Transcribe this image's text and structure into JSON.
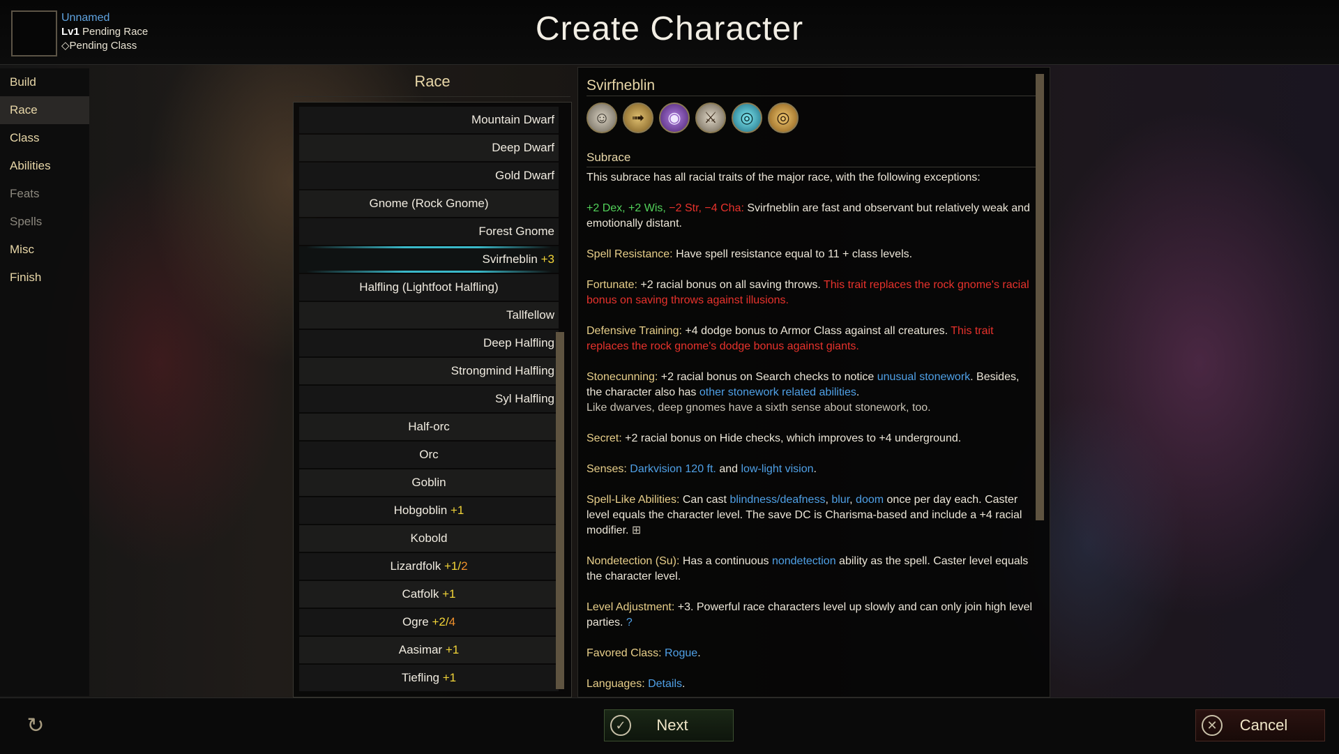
{
  "header": {
    "title": "Create Character",
    "character": {
      "name": "Unnamed",
      "level": "Lv1",
      "race": "Pending Race",
      "class": "Pending Class"
    }
  },
  "nav": {
    "items": [
      {
        "label": "Build"
      },
      {
        "label": "Race"
      },
      {
        "label": "Class"
      },
      {
        "label": "Abilities"
      },
      {
        "label": "Feats"
      },
      {
        "label": "Spells"
      },
      {
        "label": "Misc"
      },
      {
        "label": "Finish"
      }
    ]
  },
  "race_list": {
    "title": "Race",
    "items": [
      {
        "name": "Mountain Dwarf",
        "adj": ""
      },
      {
        "name": "Deep Dwarf",
        "adj": ""
      },
      {
        "name": "Gold Dwarf",
        "adj": ""
      },
      {
        "name": "Gnome (Rock Gnome)",
        "adj": ""
      },
      {
        "name": "Forest Gnome",
        "adj": ""
      },
      {
        "name": "Svirfneblin",
        "adj": "+3"
      },
      {
        "name": "Halfling (Lightfoot Halfling)",
        "adj": ""
      },
      {
        "name": "Tallfellow",
        "adj": ""
      },
      {
        "name": "Deep Halfling",
        "adj": ""
      },
      {
        "name": "Strongmind Halfling",
        "adj": ""
      },
      {
        "name": "Syl Halfling",
        "adj": ""
      },
      {
        "name": "Half-orc",
        "adj": ""
      },
      {
        "name": "Orc",
        "adj": ""
      },
      {
        "name": "Goblin",
        "adj": ""
      },
      {
        "name": "Hobgoblin",
        "adj": "+1"
      },
      {
        "name": "Kobold",
        "adj": ""
      },
      {
        "name": "Lizardfolk",
        "adj": "+1",
        "adj_sep": "/",
        "adj2": "2"
      },
      {
        "name": "Catfolk",
        "adj": "+1"
      },
      {
        "name": "Ogre",
        "adj": "+2",
        "adj_sep": "/",
        "adj2": "4"
      },
      {
        "name": "Aasimar",
        "adj": "+1"
      },
      {
        "name": "Tiefling",
        "adj": "+1"
      }
    ]
  },
  "detail": {
    "title": "Svirfneblin",
    "icons": [
      "humanoid-icon",
      "speed-icon",
      "spell-resistance-icon",
      "weapon-icon",
      "darkvision-icon",
      "low-light-vision-icon"
    ],
    "subrace_head": "Subrace",
    "intro": "This subrace has all racial traits of the major race, with the following exceptions:",
    "stats": {
      "green": "+2 Dex, +2 Wis,",
      "red": "−2 Str, −4 Cha:",
      "text": "Svirfneblin are fast and observant but relatively weak and emotionally distant."
    },
    "spell_resistance": {
      "label": "Spell Resistance:",
      "text": "Have spell resistance equal to 11 + class levels."
    },
    "fortunate": {
      "label": "Fortunate:",
      "text": "+2 racial bonus on all saving throws.",
      "red": "This trait replaces the rock gnome's racial bonus on saving throws against illusions."
    },
    "defensive": {
      "label": "Defensive Training:",
      "text": "+4 dodge bonus to Armor Class against all creatures.",
      "red": "This trait replaces the rock gnome's dodge bonus against giants."
    },
    "stonecunning": {
      "label": "Stonecunning:",
      "text1": "+2 racial bonus on Search checks to notice",
      "link1": "unusual stonework",
      "text2": ". Besides, the character also has",
      "link2": "other stonework related abilities",
      "text3": ".",
      "note": "Like dwarves, deep gnomes have a sixth sense about stonework, too."
    },
    "secret": {
      "label": "Secret:",
      "text": "+2 racial bonus on Hide checks, which improves to +4 underground."
    },
    "senses": {
      "label": "Senses:",
      "link1": "Darkvision 120 ft.",
      "text": "and",
      "link2": "low-light vision",
      "end": "."
    },
    "sla": {
      "label": "Spell-Like Abilities:",
      "text1": "Can cast",
      "link1": "blindness/deafness",
      "sep1": ",",
      "link2": "blur",
      "sep2": ",",
      "link3": "doom",
      "text2": "once per day each. Caster level equals the character level. The save DC is Charisma-based and include a +4 racial modifier.",
      "note_icon": "⊞"
    },
    "nondetection": {
      "label": "Nondetection (Su):",
      "text1": "Has a continuous",
      "link": "nondetection",
      "text2": "ability as the spell. Caster level equals the character level."
    },
    "level_adj": {
      "label": "Level Adjustment:",
      "text": "+3. Powerful race characters level up slowly and can only join high level parties.",
      "help_icon": "?"
    },
    "favored": {
      "label": "Favored Class:",
      "link": "Rogue",
      "end": "."
    },
    "languages": {
      "label": "Languages:",
      "link": "Details",
      "end": "."
    }
  },
  "footer": {
    "next_label": "Next",
    "cancel_label": "Cancel",
    "next_icon": "✓",
    "cancel_icon": "✕",
    "refresh_icon": "↻"
  }
}
